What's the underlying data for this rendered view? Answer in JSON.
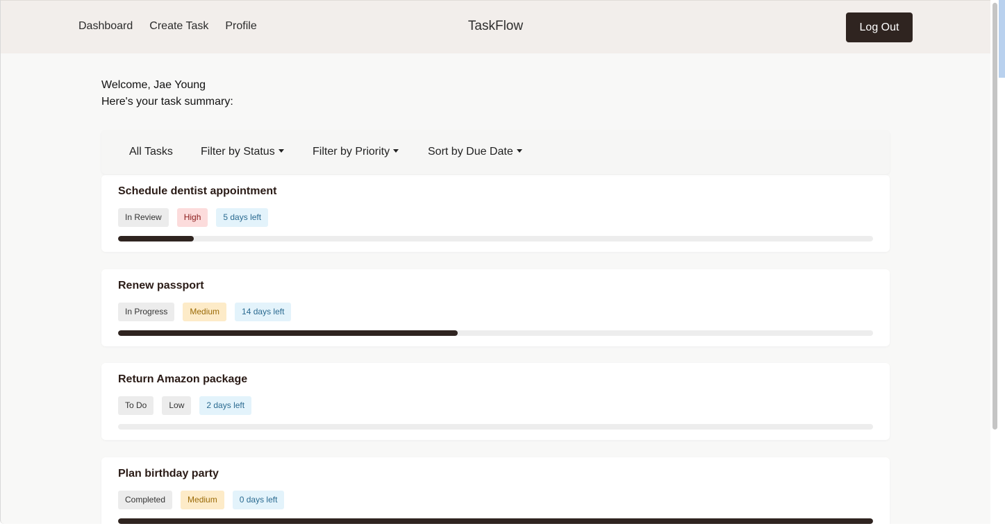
{
  "nav": {
    "links": [
      "Dashboard",
      "Create Task",
      "Profile"
    ],
    "brand": "TaskFlow",
    "logout_label": "Log Out"
  },
  "welcome": {
    "greeting": "Welcome, Jae Young",
    "subtitle": "Here's your task summary:"
  },
  "filters": {
    "all": "All Tasks",
    "status": "Filter by Status",
    "priority": "Filter by Priority",
    "sort": "Sort by Due Date"
  },
  "tasks": [
    {
      "title": "Schedule dentist appointment",
      "status": "In Review",
      "priority": "High",
      "due": "5 days left",
      "progress": 0.1
    },
    {
      "title": "Renew passport",
      "status": "In Progress",
      "priority": "Medium",
      "due": "14 days left",
      "progress": 0.45
    },
    {
      "title": "Return Amazon package",
      "status": "To Do",
      "priority": "Low",
      "due": "2 days left",
      "progress": 0
    },
    {
      "title": "Plan birthday party",
      "status": "Completed",
      "priority": "Medium",
      "due": "0 days left",
      "progress": 1.0
    }
  ]
}
